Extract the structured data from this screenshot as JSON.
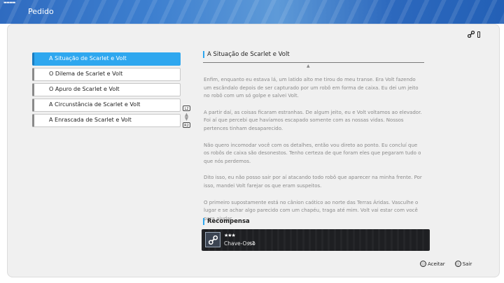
{
  "header": {
    "title": "Pedido",
    "menu_icon": "menu-icon"
  },
  "top_icons": [
    "key-icon",
    "bar-icon"
  ],
  "quests": [
    {
      "label": "A Situação de Scarlet e Volt",
      "selected": true
    },
    {
      "label": "O Dilema de Scarlet e Volt",
      "selected": false
    },
    {
      "label": "O Apuro de Scarlet e Volt",
      "selected": false
    },
    {
      "label": "A Circunstância de Scarlet e Volt",
      "selected": false
    },
    {
      "label": "A Enrascada de Scarlet e Volt",
      "selected": false
    }
  ],
  "side_controls": {
    "l2": "L2",
    "r2": "R2"
  },
  "detail": {
    "title": "A Situação de Scarlet e Volt",
    "paragraphs": [
      "Enfim, enquanto eu estava lá, um latido alto me tirou do meu transe. Era Volt fazendo um escândalo depois de ser capturado por um robô em forma de caixa. Eu dei um jeito no robô com um só golpe e salvei Volt.",
      "A partir daí, as coisas ficaram estranhas. De algum jeito, eu e Volt voltamos ao elevador. Foi aí que percebi que havíamos escapado somente com as nossas vidas. Nossos pertences tinham desaparecido.",
      "Não quero incomodar você com os detalhes, então vou direto ao ponto. Eu concluí que os robôs de caixa são desonestos. Tenho certeza de que foram eles que pegaram tudo o que nós perdemos.",
      "Dito isso, eu não posso sair por aí atacando todo robô que aparecer na minha frente. Por isso, mandei Volt farejar os que eram suspeitos.",
      "O primeiro supostamente está no cânion caótico ao norte das Terras Áridas. Vasculhe o lugar e se achar algo parecido com um chapéu, traga até mim. Volt vai estar com você para ajudar."
    ]
  },
  "reward": {
    "heading": "Recompensa",
    "stars": "★★★",
    "name": "Chave-Osso",
    "quantity": "×2",
    "icon": "bone-key-icon"
  },
  "bottom_controls": {
    "accept": {
      "button": "○",
      "label": "Aceitar"
    },
    "exit": {
      "button": "○",
      "label": "Sair"
    }
  },
  "colors": {
    "header_blue": "#3d7fcf",
    "selected_blue": "#2ea7ef",
    "reward_bg": "#1e1f22"
  }
}
